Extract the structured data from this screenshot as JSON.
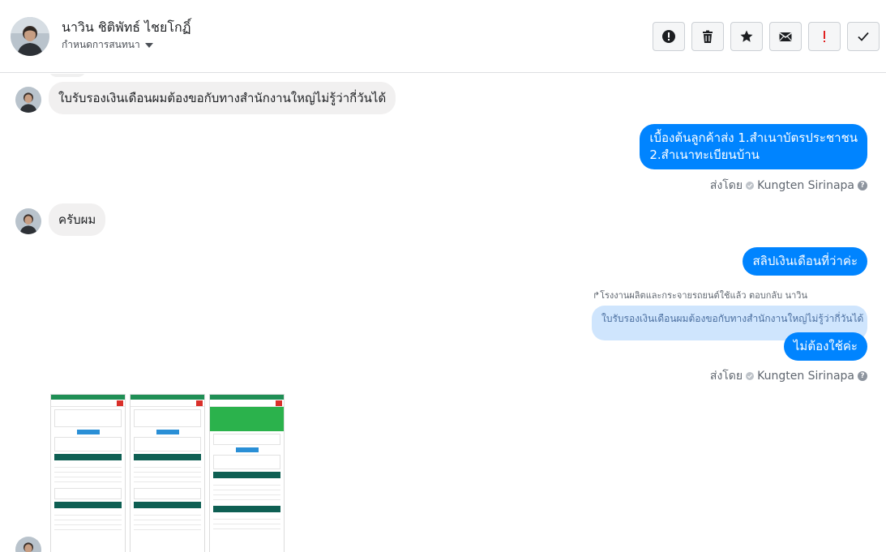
{
  "header": {
    "name": "นาวิน ชิติพัทธ์ ไชยโกฏิ์",
    "subtitle": "กำหนดการสนทนา",
    "actions": [
      {
        "id": "spam",
        "icon": "exclamation-circle-icon"
      },
      {
        "id": "delete",
        "icon": "trash-icon"
      },
      {
        "id": "star",
        "icon": "star-icon"
      },
      {
        "id": "mark-unread",
        "icon": "envelope-icon"
      },
      {
        "id": "important",
        "icon": "exclamation-icon"
      },
      {
        "id": "done",
        "icon": "checkmark-icon"
      }
    ]
  },
  "messages": {
    "in_1": "ใบรับรองเงินเดือนผมต้องขอกับทางสำนักงานใหญ่ไม่รู้ว่ากี่วันได้",
    "out_1_line1": "เบื้องต้นลูกค้าส่ง 1.สำเนาบัตรประชาชน",
    "out_1_line2": "2.สำเนาทะเบียนบ้าน",
    "sent_by_label": "ส่งโดย",
    "sent_by_name": "Kungten Sirinapa",
    "in_2": "ครับผม",
    "out_2": "สลิปเงินเดือนที่ว่าค่ะ",
    "reply_note": "โรงงานผลิตและกระจายรถยนต์ใช้แล้ว ตอบกลับ นาวิน",
    "reply_quote": "ใบรับรองเงินเดือนผมต้องขอกับทางสำนักงานใหญ่ไม่รู้ว่ากี่วันได้",
    "out_3": "ไม่ต้องใช้ค่ะ"
  },
  "colors": {
    "outgoing": "#0084ff",
    "incoming": "#f1f0f0",
    "quote": "#cfe5fd",
    "important": "#e02020"
  }
}
